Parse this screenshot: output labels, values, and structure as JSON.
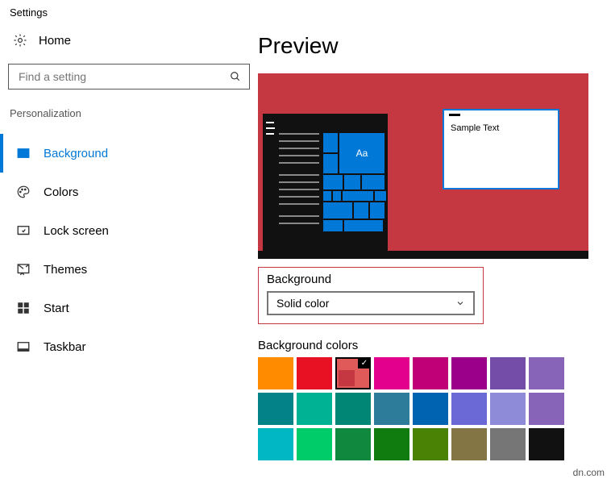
{
  "window_title": "Settings",
  "home_label": "Home",
  "search": {
    "placeholder": "Find a setting"
  },
  "sidebar": {
    "group_label": "Personalization",
    "items": [
      {
        "label": "Background"
      },
      {
        "label": "Colors"
      },
      {
        "label": "Lock screen"
      },
      {
        "label": "Themes"
      },
      {
        "label": "Start"
      },
      {
        "label": "Taskbar"
      }
    ]
  },
  "content": {
    "preview_heading": "Preview",
    "sample_text": "Sample Text",
    "tile_label": "Aa",
    "bg_dropdown": {
      "label": "Background",
      "selected": "Solid color"
    },
    "bg_colors_label": "Background colors",
    "colors": {
      "accent": "#0078d7",
      "preview_bg": "#c53842",
      "selected_swatch": "#c53842",
      "rows": [
        [
          "#ff8c00",
          "#e81123",
          "#c53842",
          "#e3008c",
          "#bf0077",
          "#9a0089",
          "#744da9",
          "#8764b8"
        ],
        [
          "#038387",
          "#00b294",
          "#018574",
          "#2d7d9a",
          "#0063b1",
          "#6b69d6",
          "#8e8cd8",
          "#8764b8"
        ],
        [
          "#00b7c3",
          "#00cc6a",
          "#10893e",
          "#107c10",
          "#498205",
          "#847545",
          "#767676",
          "#111111"
        ]
      ]
    }
  },
  "watermark": "dn.com"
}
